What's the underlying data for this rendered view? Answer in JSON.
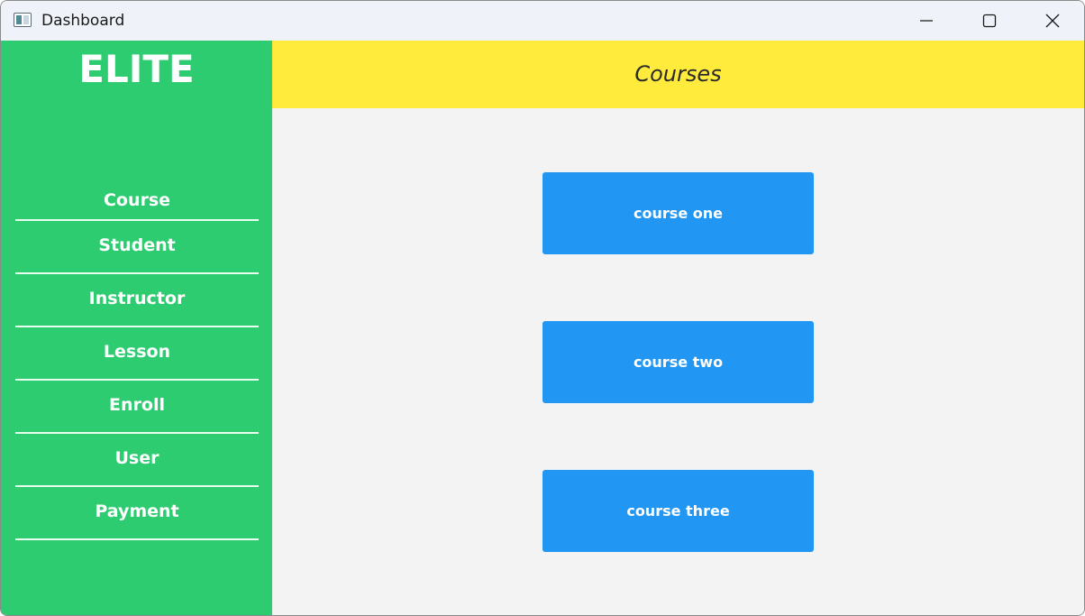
{
  "window": {
    "title": "Dashboard",
    "icons": {
      "app": "app-window-icon",
      "minimize": "minimize-icon",
      "maximize": "maximize-icon",
      "close": "close-icon"
    }
  },
  "sidebar": {
    "logo": "ELITE",
    "items": [
      {
        "label": "Course"
      },
      {
        "label": "Student"
      },
      {
        "label": "Instructor"
      },
      {
        "label": "Lesson"
      },
      {
        "label": "Enroll"
      },
      {
        "label": "User"
      },
      {
        "label": "Payment"
      }
    ]
  },
  "header": {
    "title": "Courses"
  },
  "main": {
    "courses": [
      {
        "label": "course one"
      },
      {
        "label": "course two"
      },
      {
        "label": "course three"
      }
    ]
  },
  "colors": {
    "sidebar_bg": "#2ecc71",
    "header_bg": "#ffeb3b",
    "button_bg": "#2196f3",
    "content_bg": "#f3f3f3"
  }
}
